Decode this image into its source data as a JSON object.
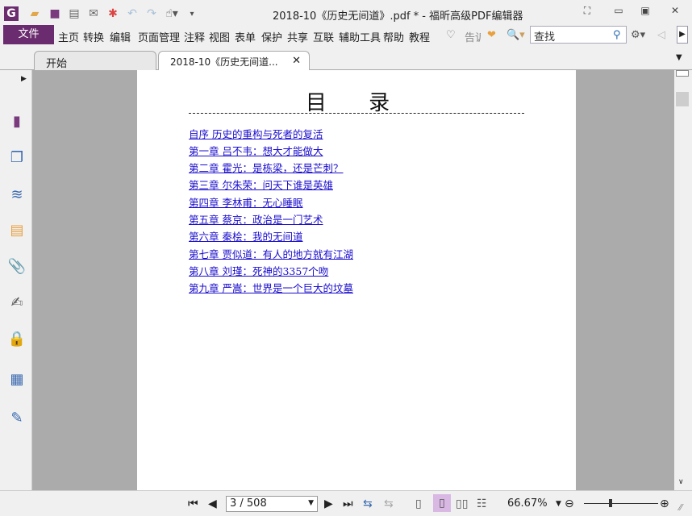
{
  "titlebar": {
    "title": "2018-10《历史无间道》.pdf * - 福昕高级PDF编辑器",
    "icons": [
      "foxit-logo-icon",
      "open-folder-icon",
      "save-icon",
      "print-icon",
      "email-icon",
      "new-icon",
      "undo-icon",
      "redo-icon",
      "hand-tool-icon",
      "customize-icon"
    ]
  },
  "menu": {
    "file": "文件",
    "items": [
      "主页",
      "转换",
      "编辑",
      "页面管理",
      "注释",
      "视图",
      "表单",
      "保护",
      "共享",
      "互联",
      "辅助工具",
      "帮助",
      "教程"
    ],
    "tell_me": "告诉",
    "search_placeholder": "查找"
  },
  "tabs": [
    {
      "label": "开始"
    },
    {
      "label": "2018-10《历史无间道...",
      "close": "✕"
    }
  ],
  "sidebar": [
    "bookmark",
    "pages",
    "layers",
    "comments",
    "attachments",
    "signatures",
    "security",
    "form-fields",
    "certify"
  ],
  "document": {
    "title": "目 录",
    "toc": [
      "自序 历史的重构与死者的复活",
      "第一章 吕不韦：想大才能做大",
      "第二章 霍光：是栋梁，还是芒刺？",
      "第三章 尔朱荣：问天下谁是英雄",
      "第四章 李林甫：无心睡眠",
      "第五章 蔡京：政治是一门艺术",
      "第六章 秦桧：我的无间道",
      "第七章 贾似道：有人的地方就有江湖",
      "第八章 刘瑾：死神的3357个吻",
      "第九章 严嵩：世界是一个巨大的坟墓"
    ]
  },
  "status": {
    "page": "3 / 508",
    "zoom": "66.67%",
    "zoom_slider_fraction": 0.35
  },
  "colors": {
    "accent": "#6b2c6f",
    "link": "#1a0dcc",
    "viewer_bg": "#ababab"
  }
}
